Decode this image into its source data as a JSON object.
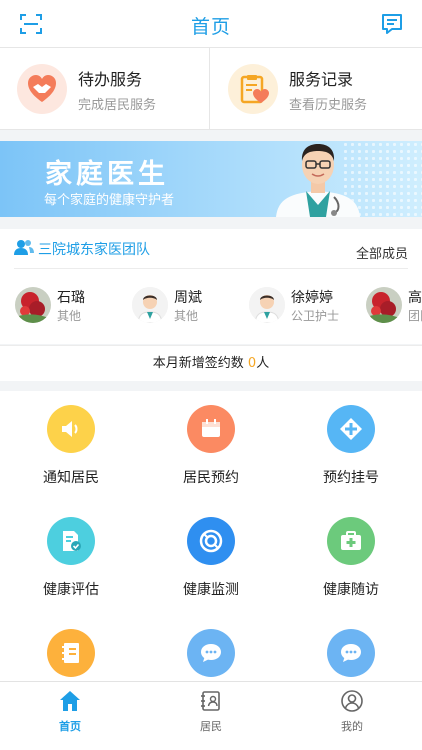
{
  "header": {
    "title": "首页",
    "left_icon": "scan-icon",
    "right_icon": "message-icon",
    "accent": "#1e9ee6"
  },
  "services": [
    {
      "title": "待办服务",
      "subtitle": "完成居民服务",
      "icon": "handshake-heart-icon"
    },
    {
      "title": "服务记录",
      "subtitle": "查看历史服务",
      "icon": "clipboard-heart-icon"
    }
  ],
  "banner": {
    "title": "家庭医生",
    "subtitle": "每个家庭的健康守护者"
  },
  "team": {
    "name": "三院城东家医团队",
    "all_members_label": "全部成员",
    "members": [
      {
        "name": "石璐",
        "role": "其他",
        "avatar": "flower-photo"
      },
      {
        "name": "周斌",
        "role": "其他",
        "avatar": "doctor-avatar"
      },
      {
        "name": "徐婷婷",
        "role": "公卫护士",
        "avatar": "doctor-avatar"
      },
      {
        "name": "高",
        "role": "团队",
        "avatar": "flower-photo"
      }
    ]
  },
  "signup": {
    "prefix": "本月新增签约数 ",
    "count": "0",
    "suffix": "人"
  },
  "grid": [
    {
      "label": "通知居民",
      "icon": "speaker-icon",
      "color": "#fdd24a"
    },
    {
      "label": "居民预约",
      "icon": "calendar-icon",
      "color": "#fb8a62"
    },
    {
      "label": "预约挂号",
      "icon": "cross-diamond-icon",
      "color": "#56b6f5"
    },
    {
      "label": "健康评估",
      "icon": "document-check-icon",
      "color": "#4dcfdf"
    },
    {
      "label": "健康监测",
      "icon": "monitor-ring-icon",
      "color": "#2f8ff0"
    },
    {
      "label": "健康随访",
      "icon": "medical-kit-icon",
      "color": "#6cca7c"
    },
    {
      "label": "",
      "icon": "notebook-icon",
      "color": "#fdb13c"
    },
    {
      "label": "",
      "icon": "chat-bubble-icon",
      "color": "#6cb4f3"
    },
    {
      "label": "",
      "icon": "chat-bubble-icon",
      "color": "#6cb4f3"
    }
  ],
  "tabbar": [
    {
      "label": "首页",
      "icon": "home-icon",
      "active": true
    },
    {
      "label": "居民",
      "icon": "resident-card-icon",
      "active": false
    },
    {
      "label": "我的",
      "icon": "user-icon",
      "active": false
    }
  ]
}
